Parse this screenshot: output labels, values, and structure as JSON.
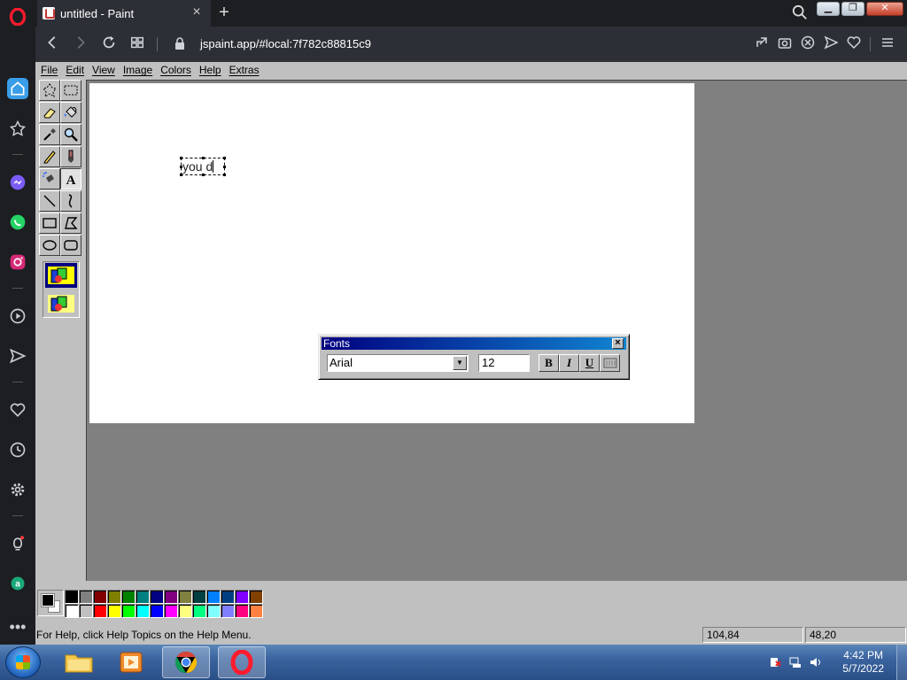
{
  "browser": {
    "tab_title": "untitled - Paint",
    "url": "jspaint.app/#local:7f782c88815c9",
    "brand_color": "#ff1b2d"
  },
  "sidebar": {
    "items": [
      "home-icon",
      "bookmarks-icon",
      "messenger-icon",
      "whatsapp-icon",
      "instagram-icon",
      "player-icon",
      "send-icon",
      "heart-icon",
      "history-icon",
      "settings-icon",
      "lightbulb-icon",
      "aria-icon",
      "more-icon"
    ]
  },
  "paint": {
    "menus": [
      "File",
      "Edit",
      "View",
      "Image",
      "Colors",
      "Help",
      "Extras"
    ],
    "canvas_text": "you d",
    "fonts_window": {
      "title": "Fonts",
      "font_name": "Arial",
      "font_size": "12",
      "bold_label": "B",
      "italic_label": "I",
      "underline_label": "U"
    },
    "palette": {
      "foreground": "#000000",
      "background": "#ffffff",
      "colors": [
        "#000000",
        "#808080",
        "#800000",
        "#808000",
        "#008000",
        "#008080",
        "#000080",
        "#800080",
        "#808040",
        "#004040",
        "#0080ff",
        "#004080",
        "#8000ff",
        "#804000",
        "#ffffff",
        "#c0c0c0",
        "#ff0000",
        "#ffff00",
        "#00ff00",
        "#00ffff",
        "#0000ff",
        "#ff00ff",
        "#ffff80",
        "#00ff80",
        "#80ffff",
        "#8080ff",
        "#ff0080",
        "#ff8040"
      ]
    },
    "status": {
      "help_text": "For Help, click Help Topics on the Help Menu.",
      "cursor_pos": "104,84",
      "selection_size": "48,20"
    }
  },
  "taskbar": {
    "time": "4:42 PM",
    "date": "5/7/2022"
  }
}
